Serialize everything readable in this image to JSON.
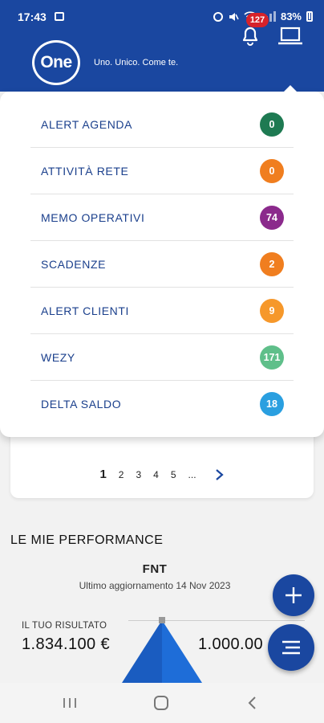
{
  "status_bar": {
    "time": "17:43",
    "battery": "83%",
    "icons": [
      "gallery-icon",
      "alarm-icon",
      "mute-icon",
      "wifi-icon",
      "signal-icon",
      "battery-icon"
    ]
  },
  "header": {
    "logo_text": "One",
    "tagline": "Uno. Unico. Come te.",
    "notification_count": "127",
    "brand_color": "#1a47a0"
  },
  "menu": {
    "items": [
      {
        "label": "ALERT AGENDA",
        "count": "0",
        "color": "#1e7a52"
      },
      {
        "label": "ATTIVITÀ RETE",
        "count": "0",
        "color": "#f07e1f"
      },
      {
        "label": "MEMO OPERATIVI",
        "count": "74",
        "color": "#8b2a8c"
      },
      {
        "label": "SCADENZE",
        "count": "2",
        "color": "#f07e1f"
      },
      {
        "label": "ALERT CLIENTI",
        "count": "9",
        "color": "#f6982b"
      },
      {
        "label": "WEZY",
        "count": "171",
        "color": "#5fbf8a"
      },
      {
        "label": "DELTA SALDO",
        "count": "18",
        "color": "#2a9fe0"
      }
    ]
  },
  "pagination": {
    "current": "1",
    "pages": [
      "2",
      "3",
      "4",
      "5"
    ],
    "ellipsis": "..."
  },
  "performance": {
    "title": "LE MIE PERFORMANCE",
    "metric": "FNT",
    "updated": "Ultimo aggiornamento 14 Nov 2023",
    "result_label": "IL TUO RISULTATO",
    "result_value": "1.834.100 €",
    "target_value": "1.000.00"
  }
}
